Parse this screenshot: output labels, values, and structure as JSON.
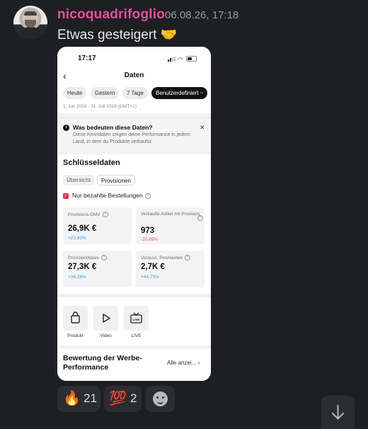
{
  "message": {
    "username": "nicoquadrifoglio",
    "timestamp": "06.08.26, 17:18",
    "text": "Etwas gesteigert 🤝"
  },
  "screenshot": {
    "status_time": "17:17",
    "nav_title": "Daten",
    "back_icon": "chevron-left-icon",
    "filters": [
      "Heute",
      "Gestern",
      "7 Tage",
      "Benutzerdefiniert ~"
    ],
    "active_filter": "Benutzerdefiniert ~",
    "date_range": "1. Juli 2026 - 31. Juli 2026 (GMT+1)",
    "info": {
      "heading": "Was bedeuten diese Daten?",
      "description": "Diese Kenndaten zeigen deine Performance in jedem Land, in dem du Produkte verkaufst."
    },
    "section_title": "Schlüsseldaten",
    "segments": [
      "Übersicht",
      "Provisionen"
    ],
    "active_segment": "Provisionen",
    "checkbox_label": "Nur bezahlte Bestellungen",
    "metrics": [
      {
        "label": "Provisions-GMV",
        "value": "26,9K €",
        "change": "+23,82%",
        "trend": "up"
      },
      {
        "label": "Verkaufte Artikel mit Provision",
        "value": "973",
        "change": "-20,89%",
        "trend": "down"
      },
      {
        "label": "Provisionsbasis",
        "value": "27,3K €",
        "change": "+36,28%",
        "trend": "up"
      },
      {
        "label": "Vorauss. Provisionen",
        "value": "2,7K €",
        "change": "+44,75%",
        "trend": "up"
      }
    ],
    "tools": [
      {
        "label": "Produkt",
        "icon": "shopping-bag-icon"
      },
      {
        "label": "Video",
        "icon": "play-icon"
      },
      {
        "label": "LIVE",
        "icon": "live-tv-icon"
      }
    ],
    "rating_title": "Bewertung der Werbe-Performance",
    "rating_more": "Alle anzei..."
  },
  "reactions": [
    {
      "emoji": "🔥",
      "count": "21"
    },
    {
      "emoji": "💯",
      "count": "2"
    }
  ],
  "colors": {
    "background": "#1e1f22",
    "username": "#e94f9c",
    "reaction_bg": "#2b2d31",
    "change_up": "#3aa0c8",
    "change_down": "#e4564c",
    "checkbox": "#e2344f"
  }
}
